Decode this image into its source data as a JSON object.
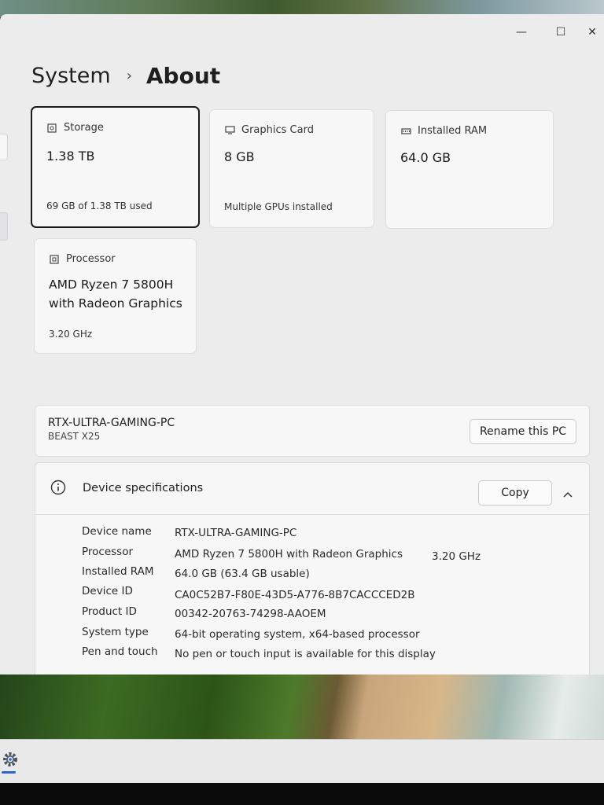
{
  "window": {
    "controls": {
      "minimize": "—",
      "maximize": "☐",
      "close": "✕"
    }
  },
  "breadcrumb": {
    "parent": "System",
    "separator": "›",
    "current": "About"
  },
  "cards": {
    "storage": {
      "label": "Storage",
      "value": "1.38 TB",
      "sub": "69 GB of 1.38 TB used"
    },
    "graphics": {
      "label": "Graphics Card",
      "value": "8 GB",
      "sub": "Multiple GPUs installed"
    },
    "ram": {
      "label": "Installed RAM",
      "value": "64.0 GB"
    },
    "processor": {
      "label": "Processor",
      "value_line1": "AMD Ryzen 7 5800H",
      "value_line2": "with Radeon Graphics",
      "sub": "3.20 GHz"
    }
  },
  "pc": {
    "name": "RTX-ULTRA-GAMING-PC",
    "model": "BEAST X25",
    "rename_label": "Rename this PC"
  },
  "device_specs": {
    "title": "Device specifications",
    "copy_label": "Copy",
    "rows": [
      {
        "label": "Device name",
        "value": "RTX-ULTRA-GAMING-PC"
      },
      {
        "label": "Processor",
        "value": "AMD Ryzen 7 5800H with Radeon Graphics",
        "extra": "3.20 GHz"
      },
      {
        "label": "Installed RAM",
        "value": "64.0 GB (63.4 GB usable)"
      },
      {
        "label": "Device ID",
        "value": "CA0C52B7-F80E-43D5-A776-8B7CACCCED2B"
      },
      {
        "label": "Product ID",
        "value": "00342-20763-74298-AAOEM"
      },
      {
        "label": "System type",
        "value": "64-bit operating system, x64-based processor"
      },
      {
        "label": "Pen and touch",
        "value": "No pen or touch input is available for this display"
      }
    ]
  }
}
